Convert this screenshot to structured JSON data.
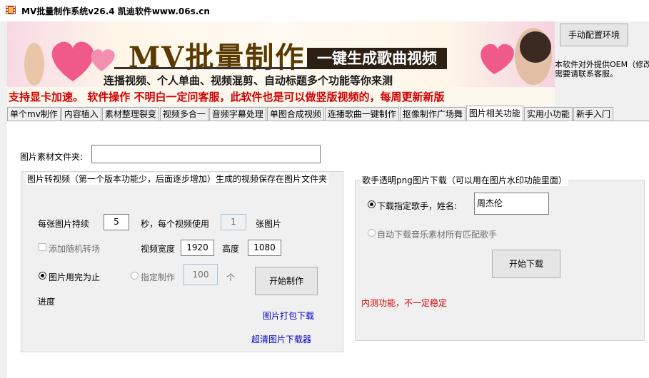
{
  "window": {
    "title": "MV批量制作系统v26.4    凯迪软件www.06s.cn"
  },
  "banner": {
    "title": "MV批量制作",
    "ribbon": "一键生成歌曲视频",
    "subtitle": "连播视频、个人单曲、视频混剪、自动标题多个功能等你来测",
    "notice": "支持显卡加速。  软件操作  不明白一定问客服，此软件也是可以做竖版视频的，每周更新新版"
  },
  "header": {
    "config_button": "手动配置环境",
    "oem_line1": "本软件对外提供OEM（修改",
    "oem_line2": "需要请联系客服。"
  },
  "tabs": [
    {
      "label": "单个mv制作"
    },
    {
      "label": "内容植入"
    },
    {
      "label": "素材整理裂变"
    },
    {
      "label": "视频多合一"
    },
    {
      "label": "音频字幕处理"
    },
    {
      "label": "单图合成视频"
    },
    {
      "label": "连播歌曲一键制作"
    },
    {
      "label": "抠像制作广场舞"
    },
    {
      "label": "图片相关功能"
    },
    {
      "label": "实用小功能"
    },
    {
      "label": "新手入门"
    }
  ],
  "active_tab": "图片相关功能",
  "image_folder": {
    "label": "图片素材文件夹:",
    "value": ""
  },
  "img2video": {
    "title": "图片转视频（第一个版本功能少，后面逐步增加）生成的视频保存在图片文件夹",
    "per_image_label": "每张图片持续",
    "per_image_value": "5",
    "sec_label": "秒，每个视频使用",
    "images_per_video_value": "1",
    "images_unit": "张图片",
    "random_transition": "添加随机转场",
    "width_label": "视频宽度",
    "width_value": "1920",
    "height_label": "高度",
    "height_value": "1080",
    "until_used_label": "图片用完为止",
    "specified_label": "指定制作",
    "specified_value": "100",
    "count_unit": "个",
    "start_button": "开始制作",
    "progress_label": "进度",
    "pack_download_link": "图片打包下载",
    "hd_downloader_link": "超清图片下载器"
  },
  "singer_png": {
    "title": "歌手透明png图片下载（可以用在图片水印功能里面）",
    "download_singer_label": "下载指定歌手，姓名:",
    "singer_name": "周杰伦",
    "auto_download_label": "自动下载音乐素材所有匹配歌手",
    "start_button": "开始下载",
    "beta_note": "内测功能，不一定稳定"
  }
}
